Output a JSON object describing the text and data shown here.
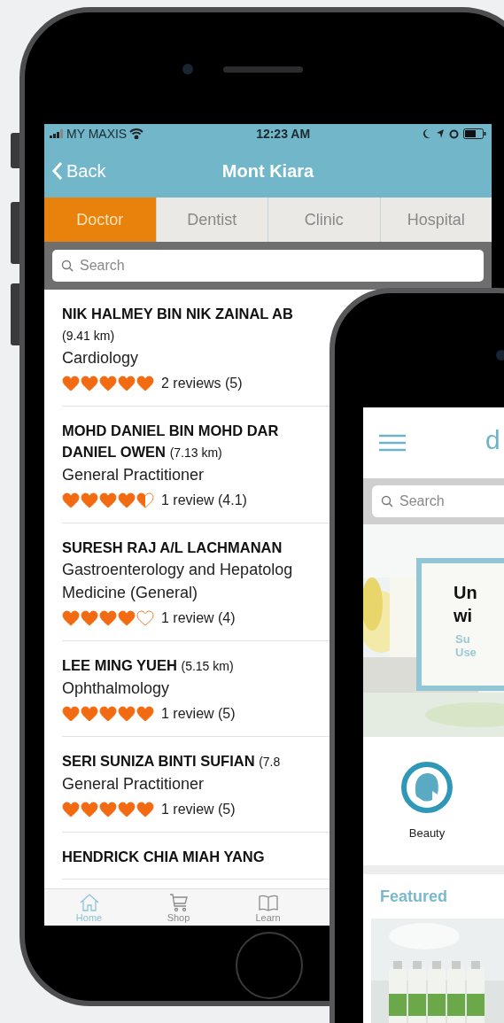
{
  "phone_left": {
    "status_bar": {
      "carrier": "MY MAXIS",
      "time": "12:23 AM"
    },
    "nav": {
      "back": "Back",
      "title": "Mont Kiara"
    },
    "tabs": [
      {
        "label": "Doctor",
        "selected": true
      },
      {
        "label": "Dentist",
        "selected": false
      },
      {
        "label": "Clinic",
        "selected": false
      },
      {
        "label": "Hospital",
        "selected": false
      }
    ],
    "search": {
      "placeholder": "Search"
    },
    "doctors": [
      {
        "name_lines": [
          "NIK HALMEY BIN NIK ZAINAL AB"
        ],
        "distance": "(9.41 km)",
        "specialty_lines": [
          "Cardiology"
        ],
        "stars": 5,
        "reviews": "2 reviews (5)"
      },
      {
        "name_lines": [
          "MOHD DANIEL BIN MOHD DAR",
          "DANIEL OWEN"
        ],
        "distance": "(7.13 km)",
        "specialty_lines": [
          "General Practitioner"
        ],
        "stars": 4.5,
        "reviews": "1 review (4.1)"
      },
      {
        "name_lines": [
          "SURESH RAJ A/L LACHMANAN"
        ],
        "specialty_lines": [
          "Gastroenterology and Hepatolog",
          "Medicine (General)"
        ],
        "stars": 4,
        "reviews": "1 review (4)"
      },
      {
        "name_lines": [
          "LEE MING YUEH"
        ],
        "distance": "(5.15 km)",
        "specialty_lines": [
          "Ophthalmology"
        ],
        "stars": 5,
        "reviews": "1 review (5)"
      },
      {
        "name_lines": [
          "SERI SUNIZA BINTI SUFIAN"
        ],
        "distance": "(7.8",
        "specialty_lines": [
          "General Practitioner"
        ],
        "stars": 5,
        "reviews": "1 review (5)"
      },
      {
        "name_lines": [
          "HENDRICK CHIA MIAH YANG"
        ]
      }
    ],
    "tab_bar": [
      {
        "label": "Home",
        "selected": true
      },
      {
        "label": "Shop",
        "selected": false
      },
      {
        "label": "Learn",
        "selected": false
      }
    ]
  },
  "phone_right": {
    "header": {
      "logo": "d"
    },
    "search": {
      "placeholder": "Search"
    },
    "banner": {
      "kind": "picture",
      "heading_lines": [
        "Un",
        "wi"
      ],
      "sub_lines": [
        "Su",
        "Use"
      ]
    },
    "categories": [
      {
        "label": "Beauty"
      }
    ],
    "featured": {
      "title": "Featured"
    }
  }
}
